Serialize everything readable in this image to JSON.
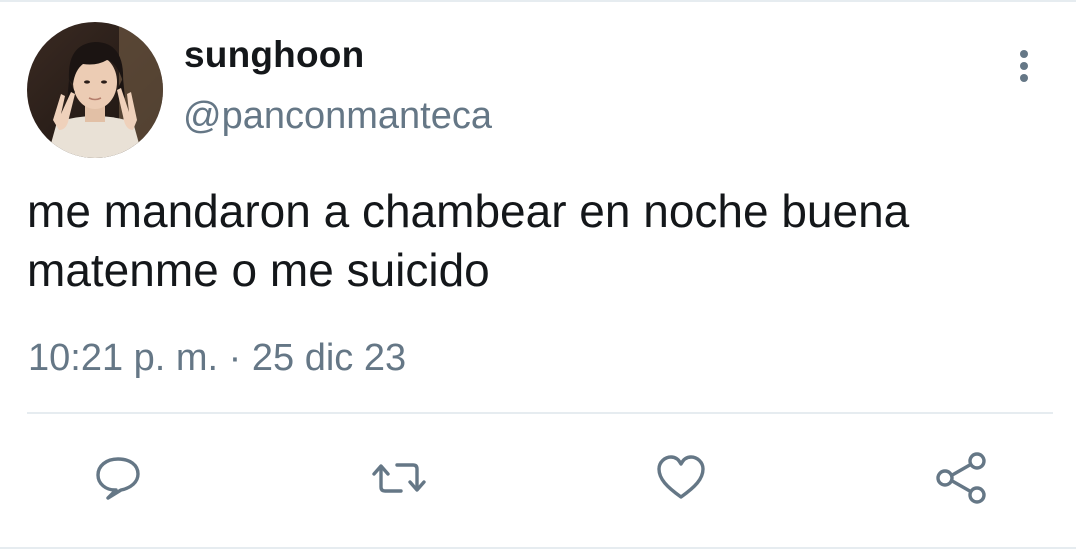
{
  "tweet": {
    "author": {
      "display_name": "sunghoon",
      "handle": "@panconmanteca",
      "avatar_icon": "profile-photo"
    },
    "text": "me mandaron a chambear en noche buena\nmatenme o me suicido",
    "timestamp": "10:21 p. m. · 25 dic 23"
  },
  "actions": [
    {
      "name": "reply",
      "icon": "comment-icon"
    },
    {
      "name": "retweet",
      "icon": "retweet-icon"
    },
    {
      "name": "like",
      "icon": "heart-icon"
    },
    {
      "name": "share",
      "icon": "share-icon"
    }
  ],
  "colors": {
    "text_primary": "#14171a",
    "text_secondary": "#657786",
    "icon": "#657786",
    "divider": "#e6ecf0"
  }
}
